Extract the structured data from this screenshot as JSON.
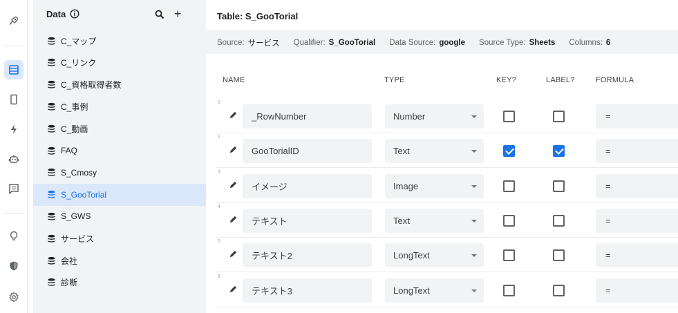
{
  "rail": {
    "icons": [
      "rocket-icon",
      "table-icon",
      "phone-icon",
      "bolt-icon",
      "robot-icon",
      "comment-icon",
      "lightbulb-icon",
      "shield-icon",
      "gear-icon"
    ],
    "active": "table-icon"
  },
  "sidebar": {
    "title": "Data",
    "add": "+",
    "tables": [
      {
        "label": "C_マップ"
      },
      {
        "label": "C_リンク"
      },
      {
        "label": "C_資格取得者数"
      },
      {
        "label": "C_事例"
      },
      {
        "label": "C_動画"
      },
      {
        "label": "FAQ"
      },
      {
        "label": "S_Cmosy"
      },
      {
        "label": "S_GooTorial"
      },
      {
        "label": "S_GWS"
      },
      {
        "label": "サービス"
      },
      {
        "label": "会社"
      },
      {
        "label": "診断"
      }
    ],
    "selected": "S_GooTorial"
  },
  "main": {
    "title": "Table: S_GooTorial",
    "meta": {
      "source_label": "Source:",
      "source_value": "サービス",
      "qualifier_label": "Qualifier:",
      "qualifier_value": "S_GooTorial",
      "datasource_label": "Data Source:",
      "datasource_value": "google",
      "sourcetype_label": "Source Type:",
      "sourcetype_value": "Sheets",
      "columns_label": "Columns:",
      "columns_value": "6"
    },
    "columns": {
      "name": "NAME",
      "type": "TYPE",
      "key": "KEY?",
      "label": "LABEL?",
      "formula": "FORMULA"
    },
    "rows": [
      {
        "index": "1",
        "name": "_RowNumber",
        "type": "Number",
        "key": false,
        "label": false,
        "formula": "="
      },
      {
        "index": "2",
        "name": "GooTorialID",
        "type": "Text",
        "key": true,
        "label": true,
        "formula": "="
      },
      {
        "index": "3",
        "name": "イメージ",
        "type": "Image",
        "key": false,
        "label": false,
        "formula": "="
      },
      {
        "index": "4",
        "name": "テキスト",
        "type": "Text",
        "key": false,
        "label": false,
        "formula": "="
      },
      {
        "index": "5",
        "name": "テキスト2",
        "type": "LongText",
        "key": false,
        "label": false,
        "formula": "="
      },
      {
        "index": "6",
        "name": "テキスト3",
        "type": "LongText",
        "key": false,
        "label": false,
        "formula": "="
      }
    ]
  },
  "colors": {
    "accent": "#1a73e8",
    "selected_bg": "#dbe7fb",
    "panel_bg": "#f1f3f4"
  }
}
